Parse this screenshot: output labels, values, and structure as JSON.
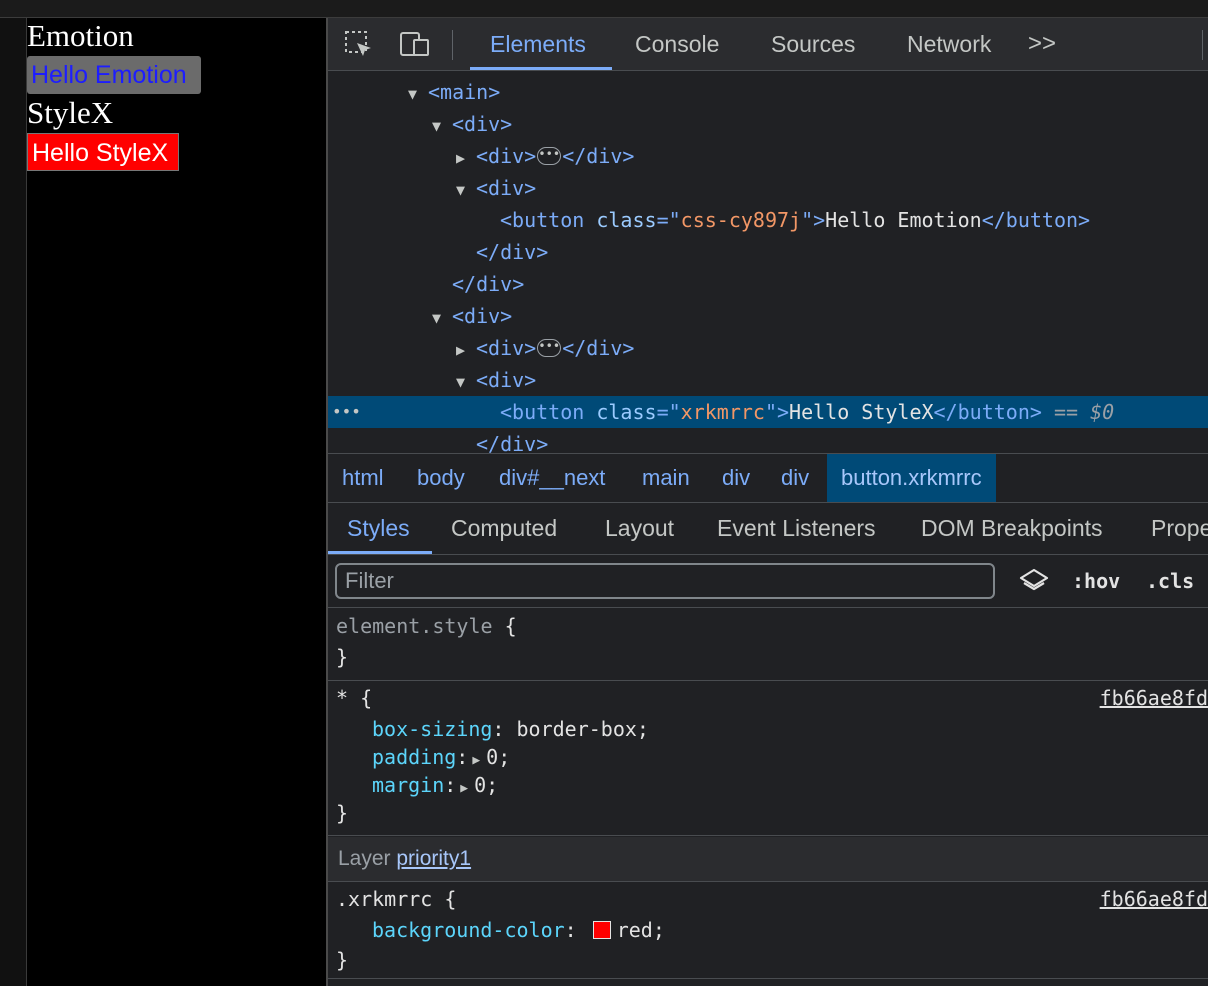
{
  "page": {
    "heading_emotion": "Emotion",
    "button_emotion": "Hello Emotion",
    "heading_stylex": "StyleX",
    "button_stylex": "Hello StyleX"
  },
  "devtools": {
    "tabs": [
      "Elements",
      "Console",
      "Sources",
      "Network"
    ],
    "overflow": ">>",
    "dom": {
      "main_open": "<main>",
      "div_open": "<div>",
      "div_close": "</div>",
      "button_emotion": {
        "open": "<button",
        "attr": "class",
        "eq_quote": "=\"",
        "value": "css-cy897j",
        "close_quote": "\">",
        "text": "Hello Emotion",
        "end": "</button>"
      },
      "button_stylex": {
        "open": "<button",
        "attr": "class",
        "eq_quote": "=\"",
        "value": "xrkmrrc",
        "close_quote": "\">",
        "text": "Hello StyleX",
        "end": "</button>",
        "marker": "== $0"
      },
      "selection_dots": "•••"
    },
    "breadcrumbs": [
      "html",
      "body",
      "div#__next",
      "main",
      "div",
      "div",
      "button.xrkmrrc"
    ],
    "subtabs": [
      "Styles",
      "Computed",
      "Layout",
      "Event Listeners",
      "DOM Breakpoints",
      "Prope"
    ],
    "filter": {
      "placeholder": "Filter",
      "value": ""
    },
    "filter_buttons": {
      "hov": ":hov",
      "cls": ".cls"
    },
    "rules": {
      "element_style": {
        "selector": "element.style",
        "open": "{",
        "close": "}"
      },
      "universal": {
        "selector": "* {",
        "source": "fb66ae8fd",
        "props": [
          {
            "name": "box-sizing",
            "value": "border-box;"
          },
          {
            "name": "padding",
            "value": "0;"
          },
          {
            "name": "margin",
            "value": "0;"
          }
        ],
        "close": "}"
      },
      "layer": {
        "label": "Layer",
        "name": "priority1"
      },
      "xrkmrrc": {
        "selector": ".xrkmrrc {",
        "source": "fb66ae8fd",
        "prop": {
          "name": "background-color",
          "value": "red;",
          "swatch": "#ff0000"
        },
        "close": "}"
      }
    }
  }
}
